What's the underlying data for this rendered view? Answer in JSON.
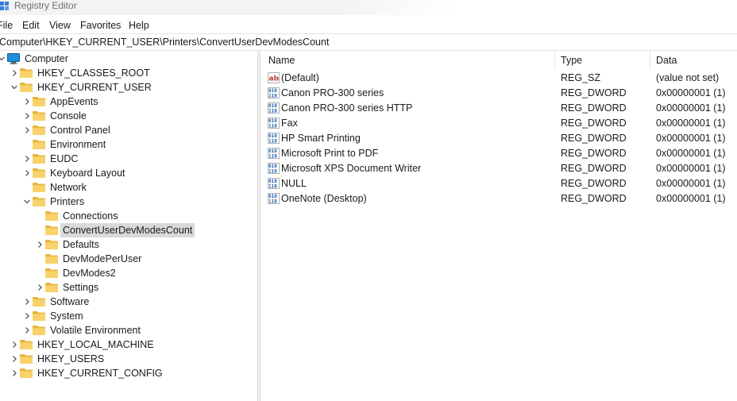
{
  "window": {
    "title": "Registry Editor"
  },
  "menu": [
    "File",
    "Edit",
    "View",
    "Favorites",
    "Help"
  ],
  "address": {
    "path": "Computer\\HKEY_CURRENT_USER\\Printers\\ConvertUserDevModesCount"
  },
  "tree": [
    {
      "label": "Computer",
      "level": 0,
      "expander": "expanded",
      "icon": "computer-icon"
    },
    {
      "label": "HKEY_CLASSES_ROOT",
      "level": 1,
      "expander": "collapsed",
      "icon": "folder-icon"
    },
    {
      "label": "HKEY_CURRENT_USER",
      "level": 1,
      "expander": "expanded",
      "icon": "folder-icon"
    },
    {
      "label": "AppEvents",
      "level": 2,
      "expander": "collapsed",
      "icon": "folder-icon"
    },
    {
      "label": "Console",
      "level": 2,
      "expander": "collapsed",
      "icon": "folder-icon"
    },
    {
      "label": "Control Panel",
      "level": 2,
      "expander": "collapsed",
      "icon": "folder-icon"
    },
    {
      "label": "Environment",
      "level": 2,
      "expander": "none",
      "icon": "folder-icon"
    },
    {
      "label": "EUDC",
      "level": 2,
      "expander": "collapsed",
      "icon": "folder-icon"
    },
    {
      "label": "Keyboard Layout",
      "level": 2,
      "expander": "collapsed",
      "icon": "folder-icon"
    },
    {
      "label": "Network",
      "level": 2,
      "expander": "none",
      "icon": "folder-icon"
    },
    {
      "label": "Printers",
      "level": 2,
      "expander": "expanded",
      "icon": "folder-icon"
    },
    {
      "label": "Connections",
      "level": 3,
      "expander": "none",
      "icon": "folder-icon"
    },
    {
      "label": "ConvertUserDevModesCount",
      "level": 3,
      "expander": "none",
      "icon": "folder-icon",
      "selected": true
    },
    {
      "label": "Defaults",
      "level": 3,
      "expander": "collapsed",
      "icon": "folder-icon"
    },
    {
      "label": "DevModePerUser",
      "level": 3,
      "expander": "none",
      "icon": "folder-icon"
    },
    {
      "label": "DevModes2",
      "level": 3,
      "expander": "none",
      "icon": "folder-icon"
    },
    {
      "label": "Settings",
      "level": 3,
      "expander": "collapsed",
      "icon": "folder-icon"
    },
    {
      "label": "Software",
      "level": 2,
      "expander": "collapsed",
      "icon": "folder-icon"
    },
    {
      "label": "System",
      "level": 2,
      "expander": "collapsed",
      "icon": "folder-icon"
    },
    {
      "label": "Volatile Environment",
      "level": 2,
      "expander": "collapsed",
      "icon": "folder-icon"
    },
    {
      "label": "HKEY_LOCAL_MACHINE",
      "level": 1,
      "expander": "collapsed",
      "icon": "folder-icon"
    },
    {
      "label": "HKEY_USERS",
      "level": 1,
      "expander": "collapsed",
      "icon": "folder-icon"
    },
    {
      "label": "HKEY_CURRENT_CONFIG",
      "level": 1,
      "expander": "collapsed",
      "icon": "folder-icon"
    }
  ],
  "list": {
    "columns": [
      "Name",
      "Type",
      "Data"
    ],
    "rows": [
      {
        "name": "(Default)",
        "type": "REG_SZ",
        "data": "(value not set)",
        "icon": "string-value-icon"
      },
      {
        "name": "Canon PRO-300 series",
        "type": "REG_DWORD",
        "data": "0x00000001 (1)",
        "icon": "binary-value-icon"
      },
      {
        "name": "Canon PRO-300 series HTTP",
        "type": "REG_DWORD",
        "data": "0x00000001 (1)",
        "icon": "binary-value-icon"
      },
      {
        "name": "Fax",
        "type": "REG_DWORD",
        "data": "0x00000001 (1)",
        "icon": "binary-value-icon"
      },
      {
        "name": "HP Smart Printing",
        "type": "REG_DWORD",
        "data": "0x00000001 (1)",
        "icon": "binary-value-icon"
      },
      {
        "name": "Microsoft Print to PDF",
        "type": "REG_DWORD",
        "data": "0x00000001 (1)",
        "icon": "binary-value-icon"
      },
      {
        "name": "Microsoft XPS Document Writer",
        "type": "REG_DWORD",
        "data": "0x00000001 (1)",
        "icon": "binary-value-icon"
      },
      {
        "name": "NULL",
        "type": "REG_DWORD",
        "data": "0x00000001 (1)",
        "icon": "binary-value-icon"
      },
      {
        "name": "OneNote (Desktop)",
        "type": "REG_DWORD",
        "data": "0x00000001 (1)",
        "icon": "binary-value-icon"
      }
    ]
  },
  "colors": {
    "folder": "#f8d26a",
    "folder_dark": "#e8b43c",
    "selection": "#d9d9d9",
    "computer": "#1e8fd6"
  }
}
